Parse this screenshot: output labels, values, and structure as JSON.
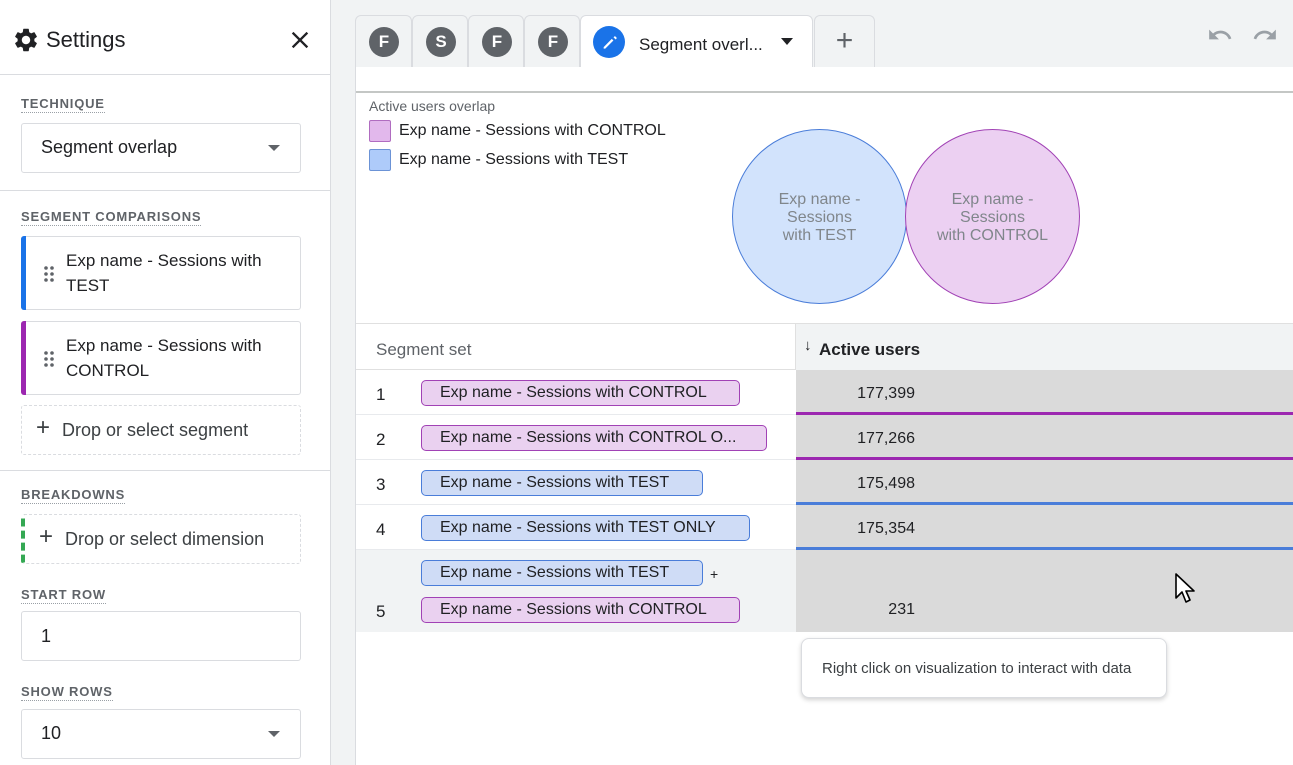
{
  "settings": {
    "title": "Settings",
    "technique_label": "TECHNIQUE",
    "technique_value": "Segment overlap",
    "segment_comparisons_label": "SEGMENT COMPARISONS",
    "segments": [
      {
        "label": "Exp name - Sessions with TEST",
        "color": "#1a73e8"
      },
      {
        "label": "Exp name - Sessions with CONTROL",
        "color": "#9c27b0"
      }
    ],
    "drop_segment": "Drop or select segment",
    "breakdowns_label": "BREAKDOWNS",
    "drop_dimension": "Drop or select dimension",
    "start_row_label": "START ROW",
    "start_row_value": "1",
    "show_rows_label": "SHOW ROWS",
    "show_rows_value": "10"
  },
  "tabs": [
    {
      "letter": "F"
    },
    {
      "letter": "S"
    },
    {
      "letter": "F"
    },
    {
      "letter": "F"
    },
    {
      "label": "Segment overl...",
      "active": true
    }
  ],
  "visualization": {
    "title": "Active users overlap",
    "legend": [
      {
        "label": "Exp name - Sessions with CONTROL",
        "color": "#e2b8ec"
      },
      {
        "label": "Exp name - Sessions with TEST",
        "color": "#aecbfa"
      }
    ],
    "venn": [
      {
        "lines": [
          "Exp name -",
          "Sessions",
          "with TEST"
        ],
        "fill": "#d2e3fc",
        "stroke": "#4a7dd9"
      },
      {
        "lines": [
          "Exp name -",
          "Sessions",
          "with CONTROL"
        ],
        "fill": "#ecd0f2",
        "stroke": "#a142b5"
      }
    ]
  },
  "table": {
    "col_segment": "Segment set",
    "col_metric": "Active users",
    "sort_arrow": "↓",
    "rows": [
      {
        "num": "1",
        "segments": [
          "Exp name - Sessions with CONTROL"
        ],
        "value": "177,399"
      },
      {
        "num": "2",
        "segments": [
          "Exp name - Sessions with CONTROL O..."
        ],
        "value": "177,266"
      },
      {
        "num": "3",
        "segments": [
          "Exp name - Sessions with TEST"
        ],
        "value": "175,498"
      },
      {
        "num": "4",
        "segments": [
          "Exp name - Sessions with TEST ONLY"
        ],
        "value": "175,354"
      },
      {
        "num": "5",
        "segments": [
          "Exp name - Sessions with TEST",
          "Exp name - Sessions with CONTROL"
        ],
        "joiner": "+",
        "value": "231"
      }
    ]
  },
  "tooltip": "Right click on visualization to interact with data",
  "colors": {
    "control": "#9c27b0",
    "test": "#4a7dd9",
    "accent": "#1a73e8"
  }
}
